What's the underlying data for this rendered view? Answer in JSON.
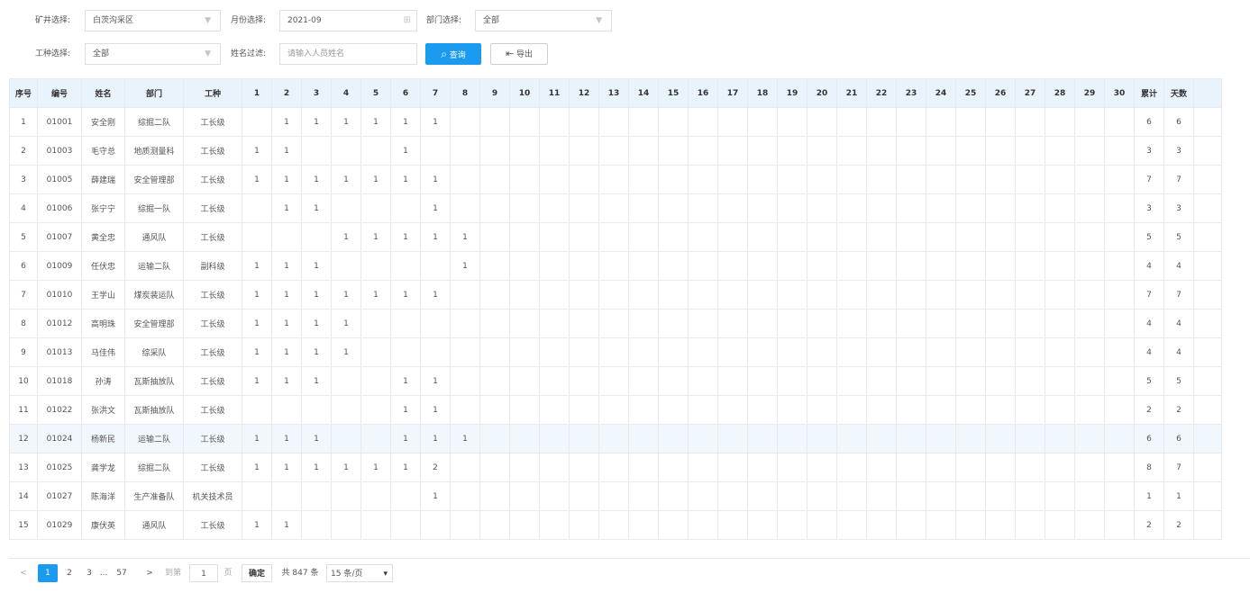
{
  "filters": {
    "mine_label": "矿井选择:",
    "mine_value": "白茨沟采区",
    "month_label": "月份选择:",
    "month_value": "2021-09",
    "dept_label": "部门选择:",
    "dept_value": "全部",
    "worktype_label": "工种选择:",
    "worktype_value": "全部",
    "name_label": "姓名过滤:",
    "name_placeholder": "请输入人员姓名",
    "search_label": "查询",
    "export_label": "导出"
  },
  "table": {
    "headers": [
      "序号",
      "编号",
      "姓名",
      "部门",
      "工种",
      "1",
      "2",
      "3",
      "4",
      "5",
      "6",
      "7",
      "8",
      "9",
      "10",
      "11",
      "12",
      "13",
      "14",
      "15",
      "16",
      "17",
      "18",
      "19",
      "20",
      "21",
      "22",
      "23",
      "24",
      "25",
      "26",
      "27",
      "28",
      "29",
      "30",
      "累计",
      "天数"
    ],
    "rows": [
      {
        "no": "1",
        "id": "01001",
        "name": "安全刚",
        "dept": "综掘二队",
        "type": "工长级",
        "days": [
          "",
          "1",
          "1",
          "1",
          "1",
          "1",
          "1",
          "",
          "",
          "",
          "",
          "",
          "",
          "",
          "",
          "",
          "",
          "",
          "",
          "",
          "",
          "",
          "",
          "",
          "",
          "",
          "",
          "",
          "",
          ""
        ],
        "total": "6",
        "count": "6"
      },
      {
        "no": "2",
        "id": "01003",
        "name": "毛守总",
        "dept": "地质测量科",
        "type": "工长级",
        "days": [
          "1",
          "1",
          "",
          "",
          "",
          "1",
          "",
          "",
          "",
          "",
          "",
          "",
          "",
          "",
          "",
          "",
          "",
          "",
          "",
          "",
          "",
          "",
          "",
          "",
          "",
          "",
          "",
          "",
          "",
          ""
        ],
        "total": "3",
        "count": "3"
      },
      {
        "no": "3",
        "id": "01005",
        "name": "薛建瑞",
        "dept": "安全管理部",
        "type": "工长级",
        "days": [
          "1",
          "1",
          "1",
          "1",
          "1",
          "1",
          "1",
          "",
          "",
          "",
          "",
          "",
          "",
          "",
          "",
          "",
          "",
          "",
          "",
          "",
          "",
          "",
          "",
          "",
          "",
          "",
          "",
          "",
          "",
          ""
        ],
        "total": "7",
        "count": "7"
      },
      {
        "no": "4",
        "id": "01006",
        "name": "张宁宁",
        "dept": "综掘一队",
        "type": "工长级",
        "days": [
          "",
          "1",
          "1",
          "",
          "",
          "",
          "1",
          "",
          "",
          "",
          "",
          "",
          "",
          "",
          "",
          "",
          "",
          "",
          "",
          "",
          "",
          "",
          "",
          "",
          "",
          "",
          "",
          "",
          "",
          ""
        ],
        "total": "3",
        "count": "3"
      },
      {
        "no": "5",
        "id": "01007",
        "name": "黄全忠",
        "dept": "通风队",
        "type": "工长级",
        "days": [
          "",
          "",
          "",
          "1",
          "1",
          "1",
          "1",
          "1",
          "",
          "",
          "",
          "",
          "",
          "",
          "",
          "",
          "",
          "",
          "",
          "",
          "",
          "",
          "",
          "",
          "",
          "",
          "",
          "",
          "",
          ""
        ],
        "total": "5",
        "count": "5"
      },
      {
        "no": "6",
        "id": "01009",
        "name": "任伏忠",
        "dept": "运输二队",
        "type": "副科级",
        "days": [
          "1",
          "1",
          "1",
          "",
          "",
          "",
          "",
          "1",
          "",
          "",
          "",
          "",
          "",
          "",
          "",
          "",
          "",
          "",
          "",
          "",
          "",
          "",
          "",
          "",
          "",
          "",
          "",
          "",
          "",
          ""
        ],
        "total": "4",
        "count": "4"
      },
      {
        "no": "7",
        "id": "01010",
        "name": "王学山",
        "dept": "煤炭装运队",
        "type": "工长级",
        "days": [
          "1",
          "1",
          "1",
          "1",
          "1",
          "1",
          "1",
          "",
          "",
          "",
          "",
          "",
          "",
          "",
          "",
          "",
          "",
          "",
          "",
          "",
          "",
          "",
          "",
          "",
          "",
          "",
          "",
          "",
          "",
          ""
        ],
        "total": "7",
        "count": "7"
      },
      {
        "no": "8",
        "id": "01012",
        "name": "高明珠",
        "dept": "安全管理部",
        "type": "工长级",
        "days": [
          "1",
          "1",
          "1",
          "1",
          "",
          "",
          "",
          "",
          "",
          "",
          "",
          "",
          "",
          "",
          "",
          "",
          "",
          "",
          "",
          "",
          "",
          "",
          "",
          "",
          "",
          "",
          "",
          "",
          "",
          ""
        ],
        "total": "4",
        "count": "4"
      },
      {
        "no": "9",
        "id": "01013",
        "name": "马佳伟",
        "dept": "综采队",
        "type": "工长级",
        "days": [
          "1",
          "1",
          "1",
          "1",
          "",
          "",
          "",
          "",
          "",
          "",
          "",
          "",
          "",
          "",
          "",
          "",
          "",
          "",
          "",
          "",
          "",
          "",
          "",
          "",
          "",
          "",
          "",
          "",
          "",
          ""
        ],
        "total": "4",
        "count": "4"
      },
      {
        "no": "10",
        "id": "01018",
        "name": "孙涛",
        "dept": "瓦斯抽放队",
        "type": "工长级",
        "days": [
          "1",
          "1",
          "1",
          "",
          "",
          "1",
          "1",
          "",
          "",
          "",
          "",
          "",
          "",
          "",
          "",
          "",
          "",
          "",
          "",
          "",
          "",
          "",
          "",
          "",
          "",
          "",
          "",
          "",
          "",
          ""
        ],
        "total": "5",
        "count": "5"
      },
      {
        "no": "11",
        "id": "01022",
        "name": "张洪文",
        "dept": "瓦斯抽放队",
        "type": "工长级",
        "days": [
          "",
          "",
          "",
          "",
          "",
          "1",
          "1",
          "",
          "",
          "",
          "",
          "",
          "",
          "",
          "",
          "",
          "",
          "",
          "",
          "",
          "",
          "",
          "",
          "",
          "",
          "",
          "",
          "",
          "",
          ""
        ],
        "total": "2",
        "count": "2"
      },
      {
        "no": "12",
        "id": "01024",
        "name": "杨新民",
        "dept": "运输二队",
        "type": "工长级",
        "days": [
          "1",
          "1",
          "1",
          "",
          "",
          "1",
          "1",
          "1",
          "",
          "",
          "",
          "",
          "",
          "",
          "",
          "",
          "",
          "",
          "",
          "",
          "",
          "",
          "",
          "",
          "",
          "",
          "",
          "",
          "",
          ""
        ],
        "total": "6",
        "count": "6"
      },
      {
        "no": "13",
        "id": "01025",
        "name": "龚学龙",
        "dept": "综掘二队",
        "type": "工长级",
        "days": [
          "1",
          "1",
          "1",
          "1",
          "1",
          "1",
          "2",
          "",
          "",
          "",
          "",
          "",
          "",
          "",
          "",
          "",
          "",
          "",
          "",
          "",
          "",
          "",
          "",
          "",
          "",
          "",
          "",
          "",
          "",
          ""
        ],
        "total": "8",
        "count": "7"
      },
      {
        "no": "14",
        "id": "01027",
        "name": "陈海洋",
        "dept": "生产准备队",
        "type": "机关技术员",
        "days": [
          "",
          "",
          "",
          "",
          "",
          "",
          "1",
          "",
          "",
          "",
          "",
          "",
          "",
          "",
          "",
          "",
          "",
          "",
          "",
          "",
          "",
          "",
          "",
          "",
          "",
          "",
          "",
          "",
          "",
          ""
        ],
        "total": "1",
        "count": "1"
      },
      {
        "no": "15",
        "id": "01029",
        "name": "康伏英",
        "dept": "通风队",
        "type": "工长级",
        "days": [
          "1",
          "1",
          "",
          "",
          "",
          "",
          "",
          "",
          "",
          "",
          "",
          "",
          "",
          "",
          "",
          "",
          "",
          "",
          "",
          "",
          "",
          "",
          "",
          "",
          "",
          "",
          "",
          "",
          "",
          ""
        ],
        "total": "2",
        "count": "2"
      }
    ]
  },
  "pagination": {
    "prev": "<",
    "pages": [
      "1",
      "2",
      "3"
    ],
    "ellipsis": "...",
    "last": "57",
    "next": ">",
    "goto_label": "到第",
    "goto_value": "1",
    "page_unit": "页",
    "confirm": "确定",
    "total": "共 847 条",
    "page_size": "15 条/页",
    "current_page": "1"
  }
}
